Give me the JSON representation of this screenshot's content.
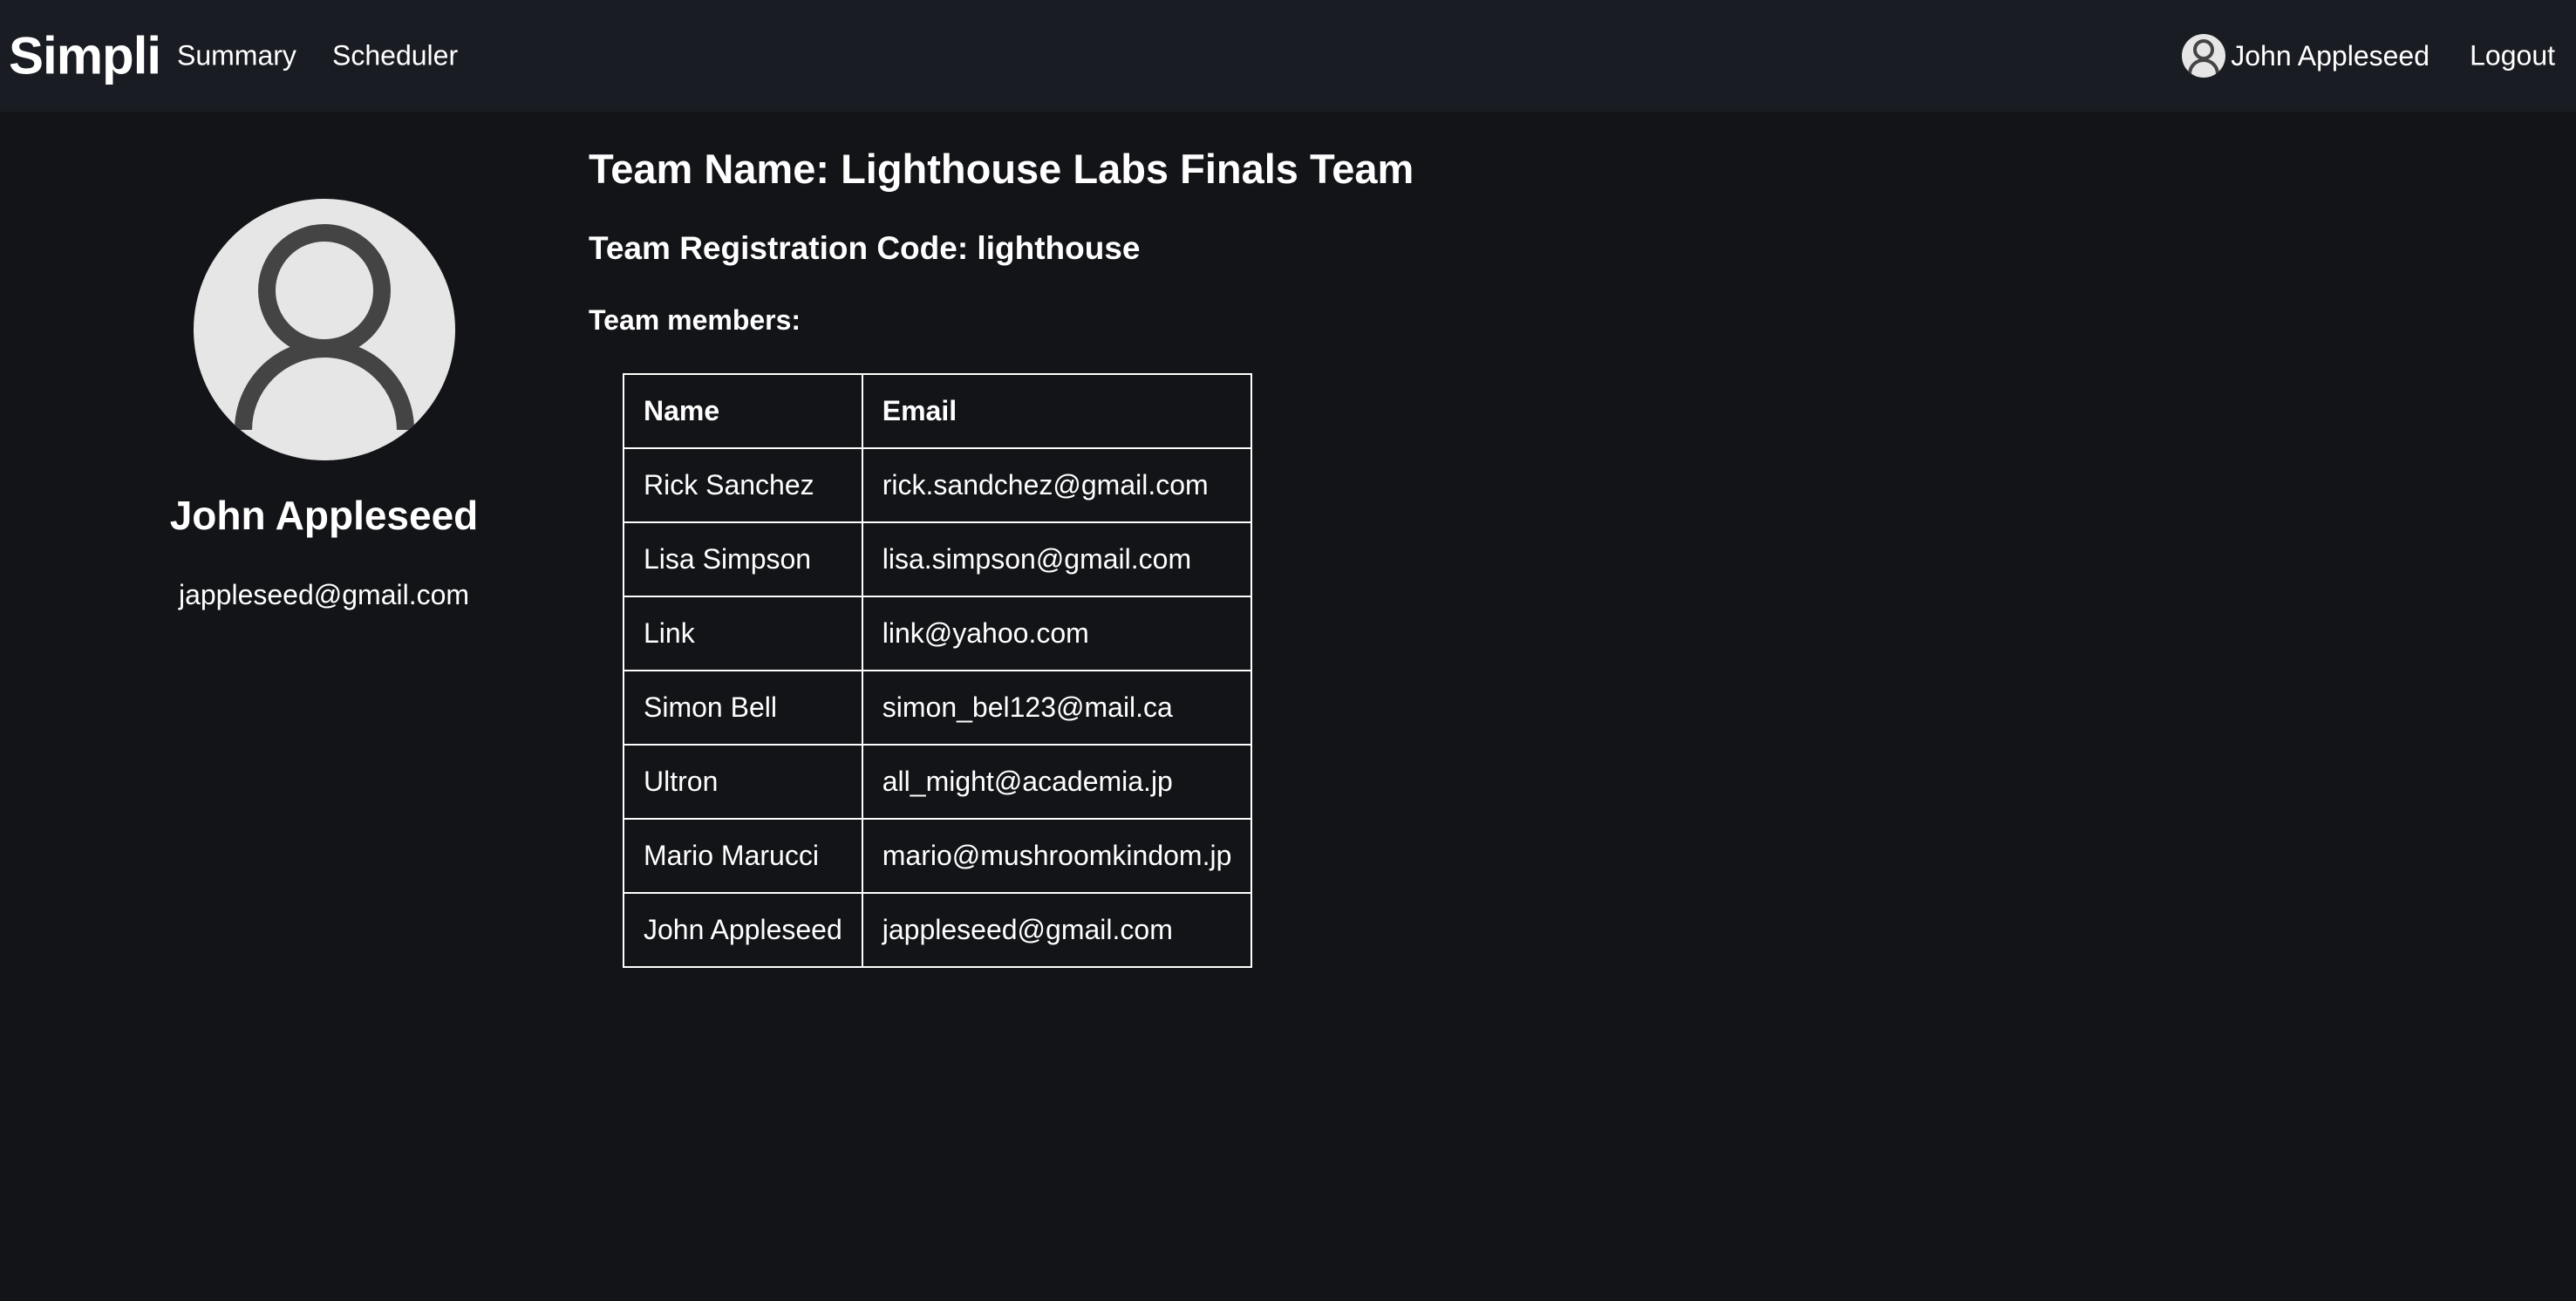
{
  "navbar": {
    "brand": "Simpli",
    "links": [
      "Summary",
      "Scheduler"
    ],
    "user_name": "John Appleseed",
    "logout_label": "Logout",
    "avatar_icon": "user-avatar-icon"
  },
  "profile": {
    "name": "John Appleseed",
    "email": "jappleseed@gmail.com",
    "avatar_icon": "user-avatar-icon"
  },
  "team": {
    "name_text": "Team Name: Lighthouse Labs Finals Team",
    "code_text": "Team Registration Code: lighthouse",
    "members_label": "Team members:",
    "table": {
      "columns": [
        "Name",
        "Email"
      ],
      "rows": [
        [
          "Rick Sanchez",
          "rick.sandchez@gmail.com"
        ],
        [
          "Lisa Simpson",
          "lisa.simpson@gmail.com"
        ],
        [
          "Link",
          "link@yahoo.com"
        ],
        [
          "Simon Bell",
          "simon_bel123@mail.ca"
        ],
        [
          "Ultron",
          "all_might@academia.jp"
        ],
        [
          "Mario Marucci",
          "mario@mushroomkindom.jp"
        ],
        [
          "John Appleseed",
          "jappleseed@gmail.com"
        ]
      ]
    }
  },
  "colors": {
    "background": "#131417",
    "navbar": "#191c22",
    "avatar_bg": "#e6e6e6",
    "avatar_fg": "#444444",
    "text": "#ffffff"
  }
}
